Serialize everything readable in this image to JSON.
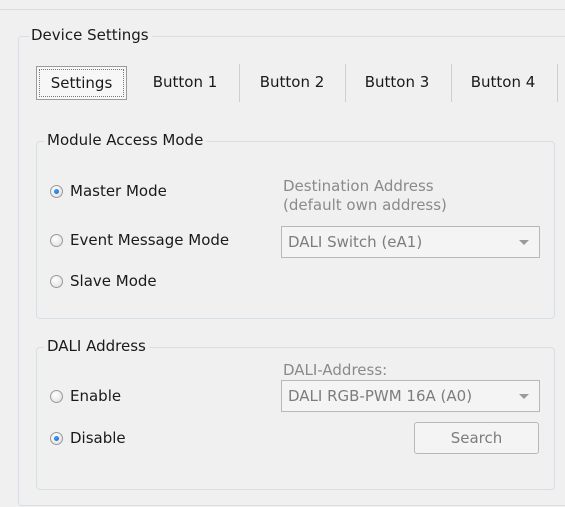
{
  "device_settings": {
    "title": "Device Settings",
    "tabs": [
      {
        "label": "Settings",
        "selected": true
      },
      {
        "label": "Button 1",
        "selected": false
      },
      {
        "label": "Button 2",
        "selected": false
      },
      {
        "label": "Button 3",
        "selected": false
      },
      {
        "label": "Button 4",
        "selected": false
      }
    ]
  },
  "module_access": {
    "title": "Module Access Mode",
    "options": [
      {
        "label": "Master Mode",
        "checked": true
      },
      {
        "label": "Event Message Mode",
        "checked": false
      },
      {
        "label": "Slave Mode",
        "checked": false
      }
    ],
    "destination_label_line1": "Destination Address",
    "destination_label_line2": "(default own address)",
    "destination_value": "DALI Switch (eA1)"
  },
  "dali_address": {
    "title": "DALI Address",
    "options": [
      {
        "label": "Enable",
        "checked": false
      },
      {
        "label": "Disable",
        "checked": true
      }
    ],
    "address_label": "DALI-Address:",
    "address_value": "DALI RGB-PWM 16A (A0)",
    "search_label": "Search"
  }
}
